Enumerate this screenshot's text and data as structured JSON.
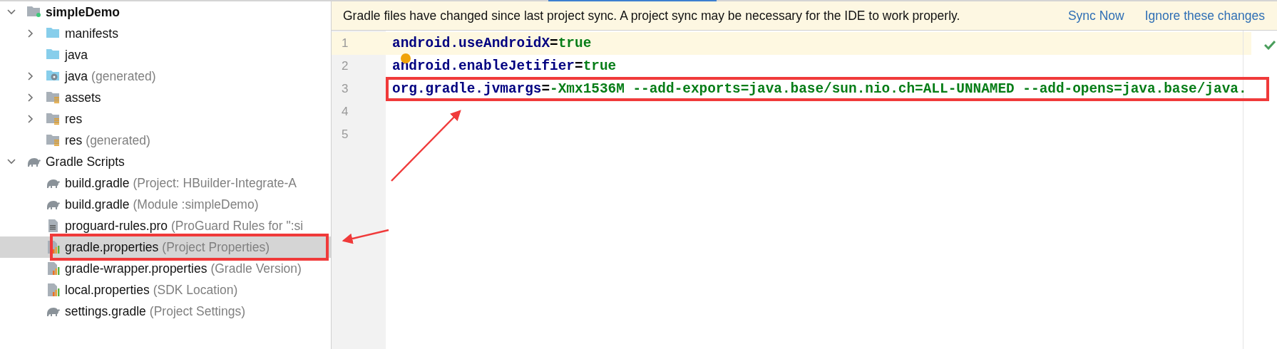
{
  "project_tree": [
    {
      "kind": "module",
      "name": "simpleDemo",
      "expanded": true,
      "selected": false,
      "children": [
        {
          "kind": "folder",
          "name": "manifests",
          "expanded": false,
          "selected": false
        },
        {
          "kind": "folder",
          "name": "java",
          "selected": false
        },
        {
          "kind": "generated-folder",
          "name": "java",
          "suffix": "(generated)",
          "expanded": false,
          "selected": false
        },
        {
          "kind": "resource-folder",
          "name": "assets",
          "expanded": false,
          "selected": false
        },
        {
          "kind": "resource-folder",
          "name": "res",
          "expanded": false,
          "selected": false
        },
        {
          "kind": "resource-folder",
          "name": "res",
          "suffix": "(generated)",
          "selected": false
        }
      ]
    },
    {
      "kind": "gradle",
      "name": "Gradle Scripts",
      "expanded": true,
      "selected": false,
      "children": [
        {
          "kind": "gradle",
          "name": "build.gradle",
          "suffix": "(Project: HBuilder-Integrate-A",
          "selected": false
        },
        {
          "kind": "gradle",
          "name": "build.gradle",
          "suffix": "(Module :simpleDemo)",
          "selected": false
        },
        {
          "kind": "text-file",
          "name": "proguard-rules.pro",
          "suffix": "(ProGuard Rules for \":si",
          "selected": false
        },
        {
          "kind": "properties",
          "name": "gradle.properties",
          "suffix": "(Project Properties)",
          "selected": true,
          "annotated": true
        },
        {
          "kind": "properties",
          "name": "gradle-wrapper.properties",
          "suffix": "(Gradle Version)",
          "selected": false
        },
        {
          "kind": "properties",
          "name": "local.properties",
          "suffix": "(SDK Location)",
          "selected": false
        },
        {
          "kind": "gradle",
          "name": "settings.gradle",
          "suffix": "(Project Settings)",
          "selected": false
        }
      ]
    }
  ],
  "banner": {
    "message": "Gradle files have changed since last project sync. A project sync may be necessary for the IDE to work properly.",
    "actions": [
      "Sync Now",
      "Ignore these changes"
    ]
  },
  "editor": {
    "lines": [
      {
        "number": "1",
        "current": true,
        "tokens": [
          {
            "kind": "key",
            "text": "android.useAndroidX"
          },
          {
            "kind": "op",
            "text": "="
          },
          {
            "kind": "value",
            "text": "true"
          }
        ]
      },
      {
        "number": "2",
        "current": false,
        "hint": true,
        "tokens": [
          {
            "kind": "key",
            "text": "android.enableJetifier"
          },
          {
            "kind": "op",
            "text": "="
          },
          {
            "kind": "value",
            "text": "true"
          }
        ]
      },
      {
        "number": "3",
        "current": false,
        "annotated": true,
        "tokens": [
          {
            "kind": "key",
            "text": "org.gradle.jvmargs"
          },
          {
            "kind": "op",
            "text": "="
          },
          {
            "kind": "value",
            "text": "-Xmx1536M --add-exports=java.base/sun.nio.ch=ALL-UNNAMED --add-opens=java.base/java."
          }
        ]
      },
      {
        "number": "4",
        "current": false
      },
      {
        "number": "5",
        "current": false
      }
    ],
    "inspection_ok": true
  }
}
